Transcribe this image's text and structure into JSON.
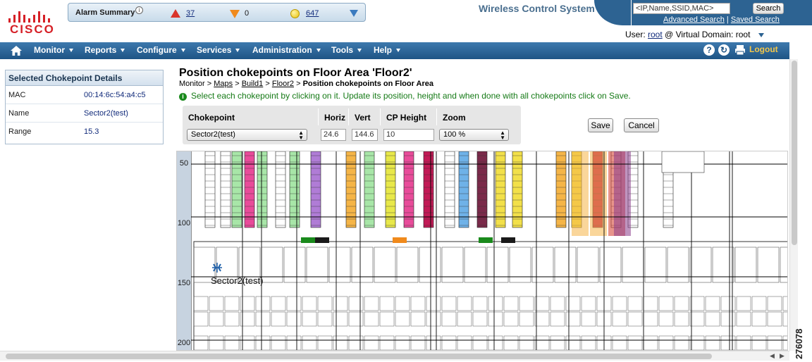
{
  "header": {
    "logo_text": "CISCO",
    "app_title": "Wireless Control System",
    "search": {
      "placeholder": "<IP,Name,SSID,MAC>",
      "button_label": "Search",
      "advanced_link": "Advanced Search",
      "separator": "|",
      "saved_link": "Saved Search"
    },
    "user": {
      "prefix": "User:",
      "name": "root",
      "domain_text": "@ Virtual Domain:",
      "domain": "root"
    }
  },
  "alarm_summary": {
    "title": "Alarm Summary",
    "critical": "37",
    "major": "0",
    "minor": "647",
    "colors": {
      "critical": "#d9352b",
      "major": "#f08a1c",
      "minor": "#e8c20a"
    }
  },
  "nav": {
    "items": [
      "Monitor",
      "Reports",
      "Configure",
      "Services",
      "Administration",
      "Tools",
      "Help"
    ],
    "logout": "Logout",
    "icons": [
      "home-icon",
      "help-icon",
      "refresh-icon",
      "print-icon"
    ]
  },
  "left_panel": {
    "title": "Selected Chokepoint Details",
    "rows": [
      {
        "key": "MAC",
        "value": "00:14:6c:54:a4:c5"
      },
      {
        "key": "Name",
        "value": "Sector2(test)"
      },
      {
        "key": "Range",
        "value": "15.3"
      }
    ]
  },
  "main": {
    "title": "Position chokepoints on Floor Area 'Floor2'",
    "breadcrumb": {
      "monitor": "Monitor >",
      "maps": "Maps",
      "sep1": ">",
      "build": "Build1",
      "sep2": ">",
      "floor": "Floor2",
      "sep3": ">",
      "current": "Position chokepoints on Floor Area"
    },
    "help_text": "Select each chokepoint by clicking on it. Update its position, height and when done with all chokepoints click on Save.",
    "form": {
      "col_chokepoint": "Chokepoint",
      "col_horiz": "Horiz",
      "col_vert": "Vert",
      "col_height": "CP Height",
      "col_zoom": "Zoom",
      "chokepoint_value": "Sector2(test)",
      "horiz_value": "24.6",
      "vert_value": "144.6",
      "height_value": "10",
      "zoom_value": "100 %"
    },
    "save_label": "Save",
    "cancel_label": "Cancel"
  },
  "map": {
    "ruler_labels": [
      "50",
      "100",
      "150",
      "200"
    ],
    "chokepoint_label": "Sector2(test)",
    "chokepoint_icon": "chokepoint-icon"
  },
  "figure_number": "276078"
}
